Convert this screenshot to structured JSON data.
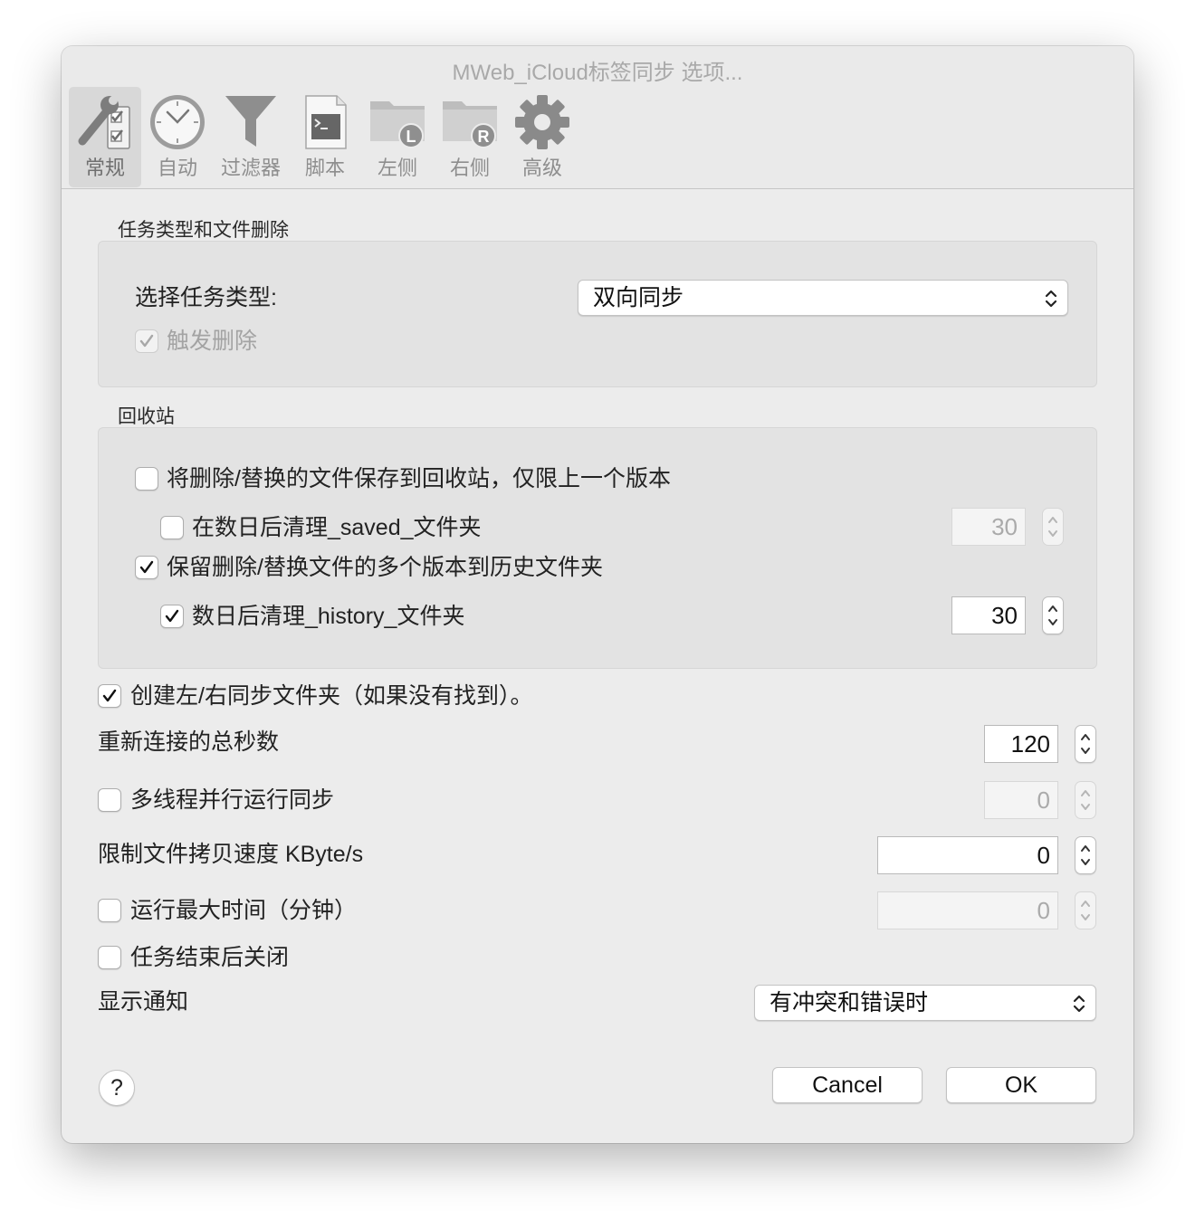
{
  "window": {
    "title": "MWeb_iCloud标签同步 选项..."
  },
  "toolbar": {
    "items": [
      {
        "label": "常规",
        "icon": "wrench-checklist-icon",
        "active": true
      },
      {
        "label": "自动",
        "icon": "clock-icon"
      },
      {
        "label": "过滤器",
        "icon": "funnel-icon"
      },
      {
        "label": "脚本",
        "icon": "script-icon"
      },
      {
        "label": "左侧",
        "icon": "folder-left-icon"
      },
      {
        "label": "右侧",
        "icon": "folder-right-icon"
      },
      {
        "label": "高级",
        "icon": "gear-icon"
      }
    ]
  },
  "task_section": {
    "title": "任务类型和文件删除",
    "task_type_label": "选择任务类型:",
    "task_type_value": "双向同步",
    "trigger_delete_label": "触发删除",
    "trigger_delete_checked": true,
    "trigger_delete_disabled": true
  },
  "recycle_section": {
    "title": "回收站",
    "save_to_recycle_label": "将删除/替换的文件保存到回收站，仅限上一个版本",
    "save_to_recycle_checked": false,
    "clean_saved_label": "在数日后清理_saved_文件夹",
    "clean_saved_checked": false,
    "clean_saved_days": "30",
    "keep_versions_label": "保留删除/替换文件的多个版本到历史文件夹",
    "keep_versions_checked": true,
    "clean_history_label": "数日后清理_history_文件夹",
    "clean_history_checked": true,
    "clean_history_days": "30"
  },
  "options": {
    "create_folders_label": "创建左/右同步文件夹（如果没有找到）。",
    "create_folders_checked": true,
    "reconnect_label": "重新连接的总秒数",
    "reconnect_value": "120",
    "multithread_label": "多线程并行运行同步",
    "multithread_checked": false,
    "multithread_value": "0",
    "speed_limit_label": "限制文件拷贝速度 KByte/s",
    "speed_limit_value": "0",
    "max_runtime_label": "运行最大时间（分钟）",
    "max_runtime_checked": false,
    "max_runtime_value": "0",
    "close_after_label": "任务结束后关闭",
    "close_after_checked": false,
    "notify_label": "显示通知",
    "notify_value": "有冲突和错误时"
  },
  "buttons": {
    "help": "?",
    "cancel": "Cancel",
    "ok": "OK"
  }
}
